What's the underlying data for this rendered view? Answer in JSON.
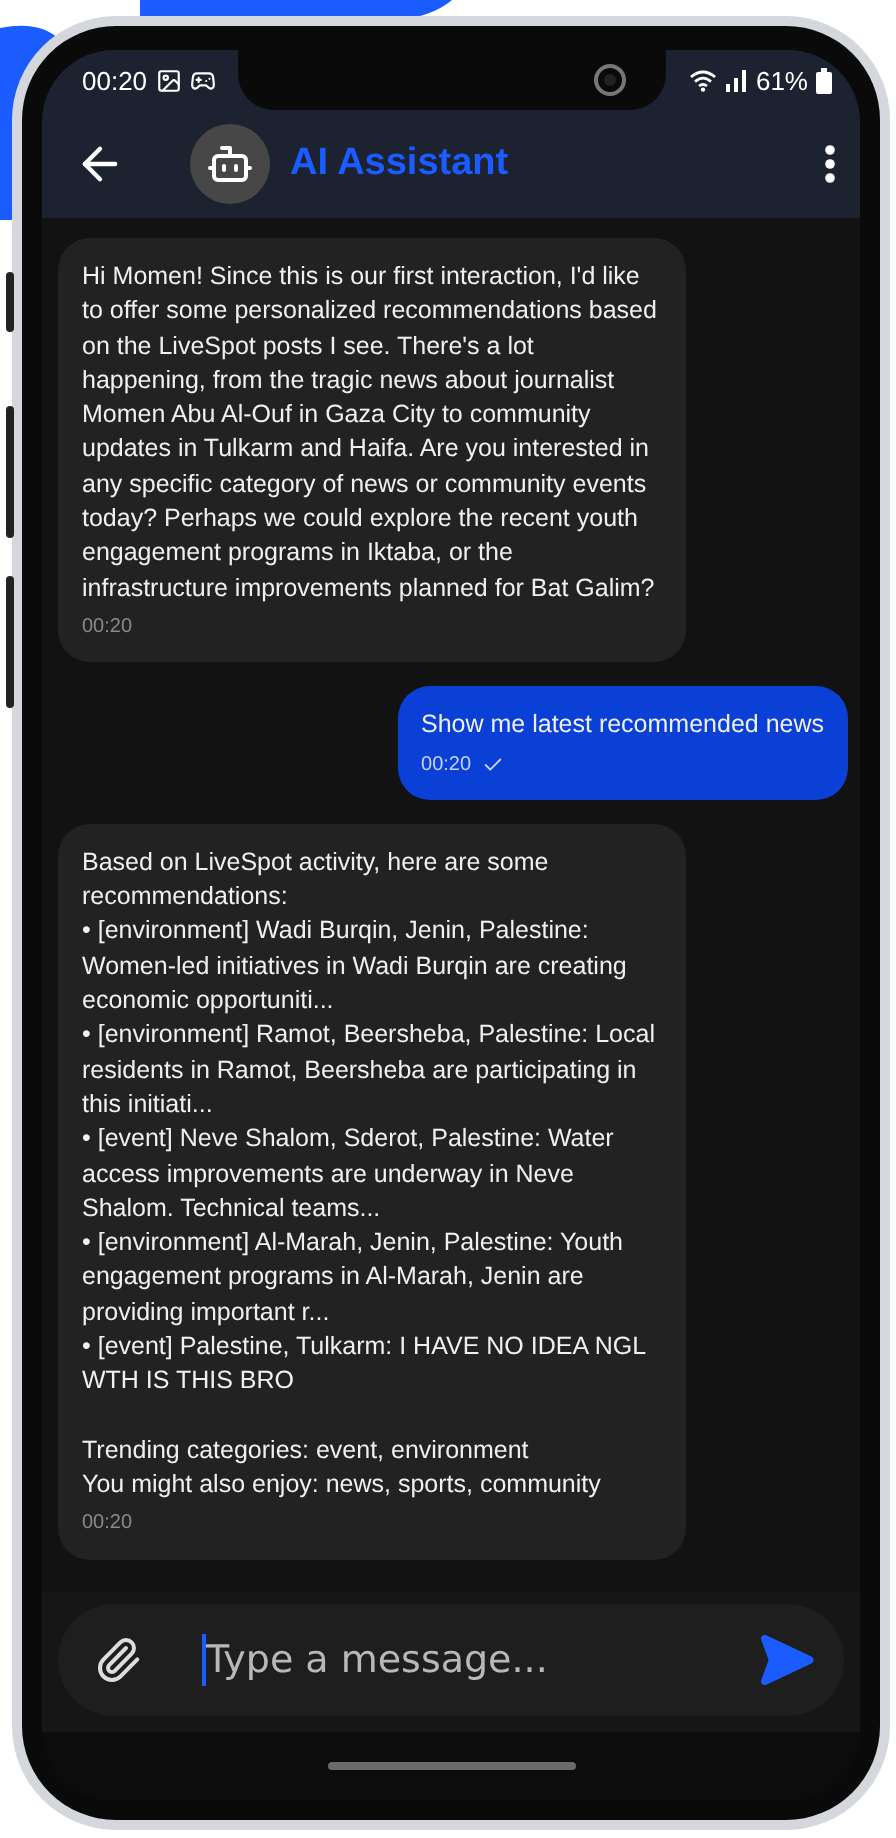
{
  "status_bar": {
    "time": "00:20",
    "battery": "61%"
  },
  "header": {
    "title": "AI Assistant"
  },
  "messages": [
    {
      "kind": "bot",
      "time": "00:20",
      "paragraphs": [
        [
          "Hi Momen! Since this is our first interaction, I'd like to offer some personalized recommendations based on the LiveSpot posts I see. There's a lot happening, from the tragic news about journalist Momen Abu Al-Ouf in Gaza City to community updates in Tulkarm and Haifa. Are you interested in any specific category of news or community events today? Perhaps we could explore the recent youth engagement programs in Iktaba, or the infrastructure improvements planned for Bat Galim?"
        ]
      ]
    },
    {
      "kind": "user",
      "time": "00:20",
      "sent": true,
      "paragraphs": [
        [
          "Show me latest recommended news"
        ]
      ]
    },
    {
      "kind": "bot",
      "time": "00:20",
      "paragraphs": [
        [
          "Based on LiveSpot activity, here are some recommendations:",
          "• [environment] Wadi Burqin, Jenin, Palestine: Women-led initiatives in Wadi Burqin are creating economic opportuniti...",
          "• [environment] Ramot, Beersheba, Palestine: Local residents in Ramot, Beersheba are participating in this initiati...",
          "• [event] Neve Shalom, Sderot, Palestine: Water access improvements are underway in Neve Shalom. Technical teams...",
          "• [environment] Al-Marah, Jenin, Palestine: Youth engagement programs in Al-Marah, Jenin are providing important r...",
          "• [event] Palestine, Tulkarm: I HAVE NO IDEA NGL WTH IS THIS BRO"
        ],
        [
          "Trending categories: event, environment",
          "You might also enjoy: news, sports, community"
        ]
      ]
    }
  ],
  "composer": {
    "placeholder": "Type a message...",
    "focused": true
  }
}
